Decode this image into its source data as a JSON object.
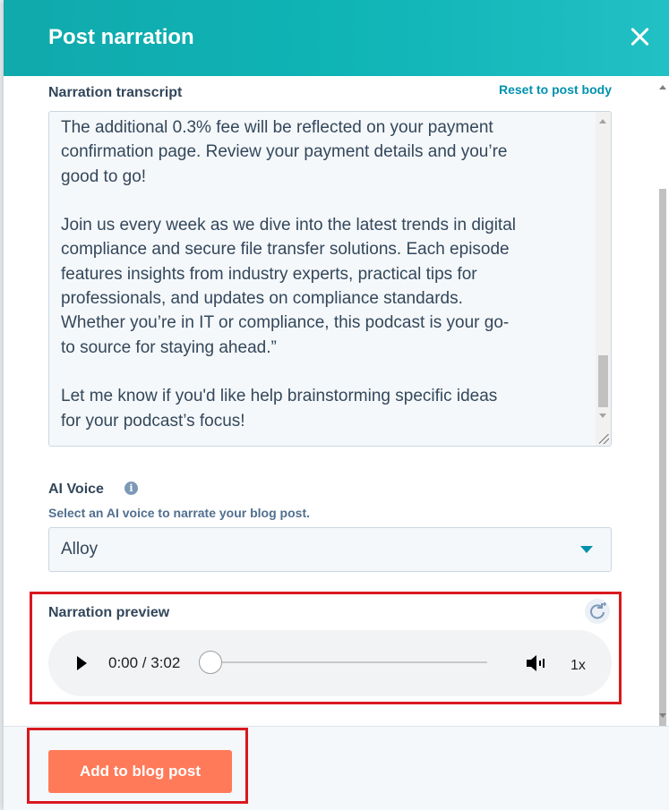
{
  "modal": {
    "title": "Post narration",
    "close_icon": "close-icon"
  },
  "transcript": {
    "label": "Narration transcript",
    "reset_link": "Reset to post body",
    "text": "The additional 0.3% fee will be reflected on your payment\nconfirmation page. Review your payment details and you’re\ngood to go!\n\nJoin us every week as we dive into the latest trends in digital\ncompliance and secure file transfer solutions. Each episode\nfeatures insights from industry experts, practical tips for\nprofessionals, and updates on compliance standards.\nWhether you’re in IT or compliance, this podcast is your go-\nto source for staying ahead.”\n\nLet me know if you'd like help brainstorming specific ideas\nfor your podcast’s focus!"
  },
  "voice": {
    "label": "AI Voice",
    "info_icon": "info-icon",
    "helper": "Select an AI voice to narrate your blog post.",
    "selected": "Alloy"
  },
  "preview": {
    "label": "Narration preview",
    "time": "0:00 / 3:02",
    "speed": "1x",
    "progress": 0,
    "icons": [
      "refresh-icon",
      "play-icon",
      "volume-icon"
    ]
  },
  "footer": {
    "primary_button": "Add to blog post"
  },
  "colors": {
    "header_start": "#10a9ac",
    "header_end": "#21c0c4",
    "link": "#0091ae",
    "primary_button": "#ff7a59",
    "highlight": "#d9181f"
  }
}
